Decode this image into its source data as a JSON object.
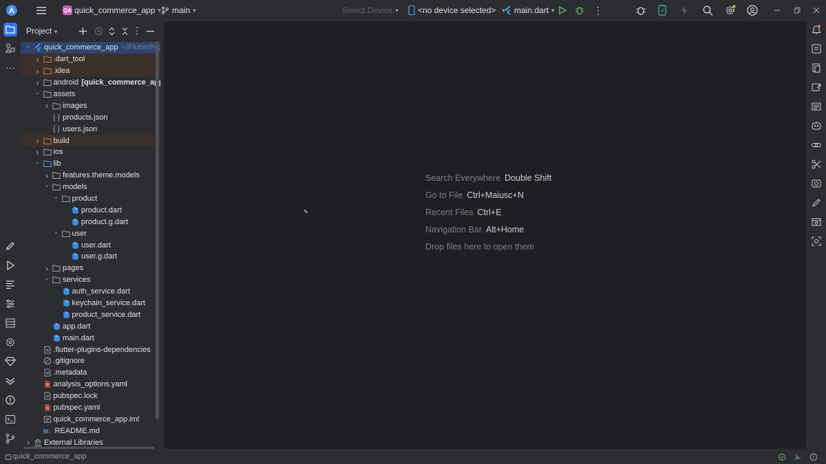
{
  "titlebar": {
    "project_badge": "QA",
    "project_name": "quick_commerce_app",
    "branch": "main",
    "device_selector": "Select Device",
    "device_status": "<no device selected>",
    "run_config": "main.dart"
  },
  "panel": {
    "title": "Project"
  },
  "tree": [
    {
      "label": "quick_commerce_app",
      "path": "~/FlutterProject",
      "depth": 0,
      "arrow": "open",
      "icon": "flutter-module-icon",
      "state": "selected"
    },
    {
      "label": ".dart_tool",
      "depth": 1,
      "arrow": "closed",
      "icon": "folder-excluded-icon",
      "state": "excluded"
    },
    {
      "label": ".idea",
      "depth": 1,
      "arrow": "closed",
      "icon": "folder-excluded-icon",
      "state": "excluded"
    },
    {
      "label": "android",
      "suffix": "[quick_commerce_app_android]",
      "depth": 1,
      "arrow": "closed",
      "icon": "folder-icon"
    },
    {
      "label": "assets",
      "depth": 1,
      "arrow": "open",
      "icon": "folder-icon"
    },
    {
      "label": "images",
      "depth": 2,
      "arrow": "closed",
      "icon": "folder-icon"
    },
    {
      "label": "products.json",
      "depth": 2,
      "arrow": "none",
      "icon": "json-file-icon"
    },
    {
      "label": "users.json",
      "depth": 2,
      "arrow": "none",
      "icon": "json-file-icon"
    },
    {
      "label": "build",
      "depth": 1,
      "arrow": "closed",
      "icon": "folder-excluded-icon",
      "state": "excluded"
    },
    {
      "label": "ios",
      "depth": 1,
      "arrow": "closed",
      "icon": "folder-icon"
    },
    {
      "label": "lib",
      "depth": 1,
      "arrow": "open",
      "icon": "folder-source-icon"
    },
    {
      "label": "features.theme.models",
      "depth": 2,
      "arrow": "closed",
      "icon": "folder-icon"
    },
    {
      "label": "models",
      "depth": 2,
      "arrow": "open",
      "icon": "folder-icon"
    },
    {
      "label": "product",
      "depth": 3,
      "arrow": "open",
      "icon": "folder-icon"
    },
    {
      "label": "product.dart",
      "depth": 4,
      "arrow": "none",
      "icon": "dart-file-icon"
    },
    {
      "label": "product.g.dart",
      "depth": 4,
      "arrow": "none",
      "icon": "dart-file-icon"
    },
    {
      "label": "user",
      "depth": 3,
      "arrow": "open",
      "icon": "folder-icon"
    },
    {
      "label": "user.dart",
      "depth": 4,
      "arrow": "none",
      "icon": "dart-file-icon"
    },
    {
      "label": "user.g.dart",
      "depth": 4,
      "arrow": "none",
      "icon": "dart-file-icon"
    },
    {
      "label": "pages",
      "depth": 2,
      "arrow": "closed",
      "icon": "folder-icon"
    },
    {
      "label": "services",
      "depth": 2,
      "arrow": "open",
      "icon": "folder-icon"
    },
    {
      "label": "auth_service.dart",
      "depth": 3,
      "arrow": "none",
      "icon": "dart-file-icon"
    },
    {
      "label": "keychain_service.dart",
      "depth": 3,
      "arrow": "none",
      "icon": "dart-file-icon"
    },
    {
      "label": "product_service.dart",
      "depth": 3,
      "arrow": "none",
      "icon": "dart-file-icon"
    },
    {
      "label": "app.dart",
      "depth": 2,
      "arrow": "none",
      "icon": "dart-file-icon"
    },
    {
      "label": "main.dart",
      "depth": 2,
      "arrow": "none",
      "icon": "dart-file-icon"
    },
    {
      "label": ".flutter-plugins-dependencies",
      "depth": 1,
      "arrow": "none",
      "icon": "text-file-icon"
    },
    {
      "label": ".gitignore",
      "depth": 1,
      "arrow": "none",
      "icon": "gitignore-file-icon"
    },
    {
      "label": ".metadata",
      "depth": 1,
      "arrow": "none",
      "icon": "text-file-icon"
    },
    {
      "label": "analysis_options.yaml",
      "depth": 1,
      "arrow": "none",
      "icon": "yaml-file-icon"
    },
    {
      "label": "pubspec.lock",
      "depth": 1,
      "arrow": "none",
      "icon": "text-file-icon"
    },
    {
      "label": "pubspec.yaml",
      "depth": 1,
      "arrow": "none",
      "icon": "yaml-file-icon"
    },
    {
      "label": "quick_commerce_app.iml",
      "depth": 1,
      "arrow": "none",
      "icon": "iml-file-icon"
    },
    {
      "label": "README.md",
      "depth": 1,
      "arrow": "none",
      "icon": "markdown-file-icon"
    },
    {
      "label": "External Libraries",
      "depth": 0,
      "arrow": "closed",
      "icon": "library-icon"
    }
  ],
  "editor_hints": [
    {
      "label": "Search Everywhere",
      "key": "Double Shift"
    },
    {
      "label": "Go to File",
      "key": "Ctrl+Maiusc+N"
    },
    {
      "label": "Recent Files",
      "key": "Ctrl+E"
    },
    {
      "label": "Navigation Bar",
      "key": "Alt+Home"
    },
    {
      "label": "Drop files here to open them",
      "key": ""
    }
  ],
  "statusbar": {
    "breadcrumb": "quick_commerce_app"
  },
  "colors": {
    "chrome_bg": "#2b2d30",
    "editor_bg": "#1e1f22",
    "selection": "#2e436e",
    "excluded_bg": "#3b3029",
    "dart_blue": "#3d8ae3",
    "folder": "#9da0a8",
    "excluded_folder": "#c77d4a",
    "badge": "#c05fb2"
  }
}
